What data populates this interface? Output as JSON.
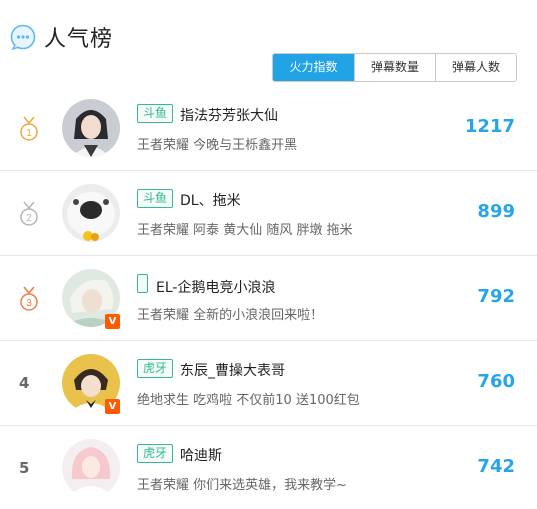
{
  "header": {
    "title": "人气榜",
    "icon": "chat-bubble-icon"
  },
  "tabs": [
    {
      "label": "火力指数",
      "active": true
    },
    {
      "label": "弹幕数量",
      "active": false
    },
    {
      "label": "弹幕人数",
      "active": false
    }
  ],
  "colors": {
    "accent": "#21a3e6",
    "score": "#26a5e8",
    "platform": "#36b893",
    "verified": "#ff5a00",
    "gold": "#f0a83a",
    "silver": "#b5b5b5",
    "bronze": "#f07a4a"
  },
  "rows": [
    {
      "rank": "1",
      "platform": "斗鱼",
      "name": "指法芬芳张大仙",
      "desc": "王者荣耀 今晚与王栎鑫开黑",
      "score": "1217"
    },
    {
      "rank": "2",
      "platform": "斗鱼",
      "name": "DL、拖米",
      "desc": "王者荣耀 阿泰 黄大仙 随风 胖墩 拖米",
      "score": "899"
    },
    {
      "rank": "3",
      "platform": "",
      "name": "EL-企鹅电竞小浪浪",
      "desc": "王者荣耀 全新的小浪浪回来啦！",
      "score": "792",
      "verified": "V"
    },
    {
      "rank": "4",
      "platform": "虎牙",
      "name": "东辰_曹操大表哥",
      "desc": "绝地求生 吃鸡啦 不仅前10 送100红包",
      "score": "760",
      "verified": "V"
    },
    {
      "rank": "5",
      "platform": "虎牙",
      "name": "哈迪斯",
      "desc": "王者荣耀 你们来选英雄，我来教学~",
      "score": "742"
    }
  ]
}
